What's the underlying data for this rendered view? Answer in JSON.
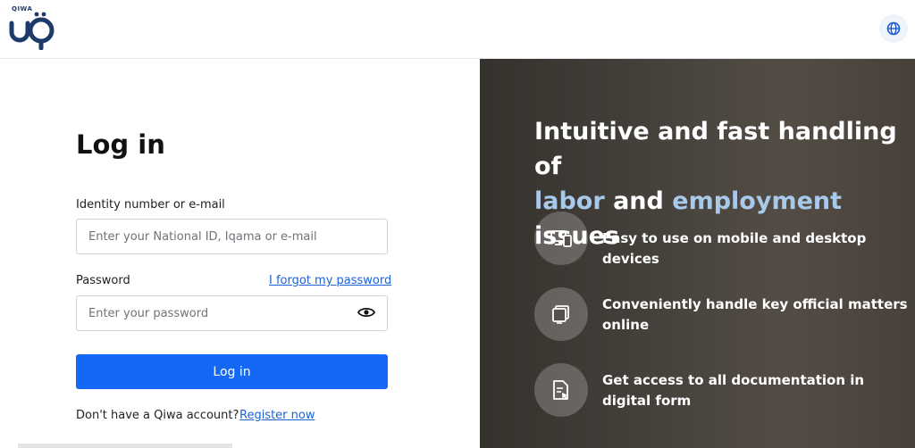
{
  "header": {
    "logo_small": "QIWA",
    "logo_icon": "qiwa-logo-icon",
    "language_icon": "globe-icon"
  },
  "login": {
    "title": "Log in",
    "identity_label": "Identity number or e-mail",
    "identity_placeholder": "Enter your National ID, Iqama or e-mail",
    "password_label": "Password",
    "forgot_label": "I forgot my password",
    "password_placeholder": "Enter your password",
    "eye_icon": "eye-icon",
    "submit_label": "Log in",
    "no_account_text": "Don't have a Qiwa account?",
    "register_label": "Register now"
  },
  "promo": {
    "headline_line1": "Intuitive and fast handling of",
    "headline_word_labor": "labor",
    "headline_and": "and",
    "headline_word_employment": "employment",
    "headline_issues": "issues",
    "features": [
      {
        "icon": "devices-icon",
        "text": "Easy to use on mobile and desktop devices"
      },
      {
        "icon": "documents-icon",
        "text": "Conveniently handle key official matters online"
      },
      {
        "icon": "document-cursor-icon",
        "text": "Get access to all documentation in digital form"
      }
    ]
  },
  "colors": {
    "primary": "#1567f5",
    "link": "#1b62d6",
    "headline_accent": "#a9c9ea"
  }
}
